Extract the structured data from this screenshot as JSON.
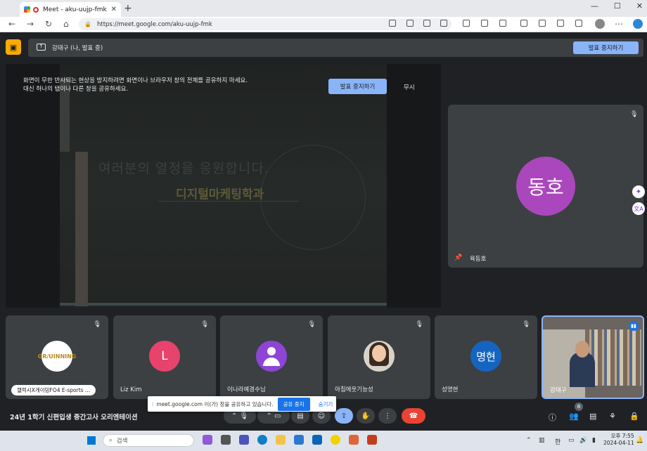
{
  "browser": {
    "tab_title": "Meet - aku-uujp-fmk",
    "url": "https://meet.google.com/aku-uujp-fmk"
  },
  "meet": {
    "presenter_label": "강태구 (나, 발표 중)",
    "stop_presenting": "발표 중지하기",
    "warning_text": "화면이 무한 반사되는 현상을 방지하려면 화면이나 브라우저 창의 전체를 공유하지 마세요.\n대신 하나의 탭이나 다른 창을 공유하세요.",
    "warning_stop": "발표 중지하기",
    "ignore": "무시",
    "slide": {
      "slogan": "여러분의 열정을 응원합니다.",
      "dept": "디지털마케팅학과"
    },
    "pinned": {
      "initials": "동호",
      "name": "육동호"
    },
    "participants": [
      {
        "name": "캘럭시X게이밍FO4 E-sports ...",
        "avatar": "GR/UINNING"
      },
      {
        "name": "Liz Kim",
        "avatar": "L"
      },
      {
        "name": "이나라예경수님",
        "avatar": ""
      },
      {
        "name": "아침에웃기능성",
        "avatar": ""
      },
      {
        "name": "성명현",
        "avatar": "명현"
      },
      {
        "name": "강태구",
        "avatar": ""
      }
    ],
    "meeting_title": "24년 1학기 신편입생 중간고사 오리엔테이션",
    "people_count": "8",
    "share_popup": {
      "text": "meet.google.com 이(가) 창을 공유하고 있습니다.",
      "share_stop": "공유 중지",
      "hide": "숨기기"
    }
  },
  "taskbar": {
    "search_placeholder": "검색",
    "ime": "한",
    "time": "오후 7:55",
    "date": "2024-04-11"
  }
}
